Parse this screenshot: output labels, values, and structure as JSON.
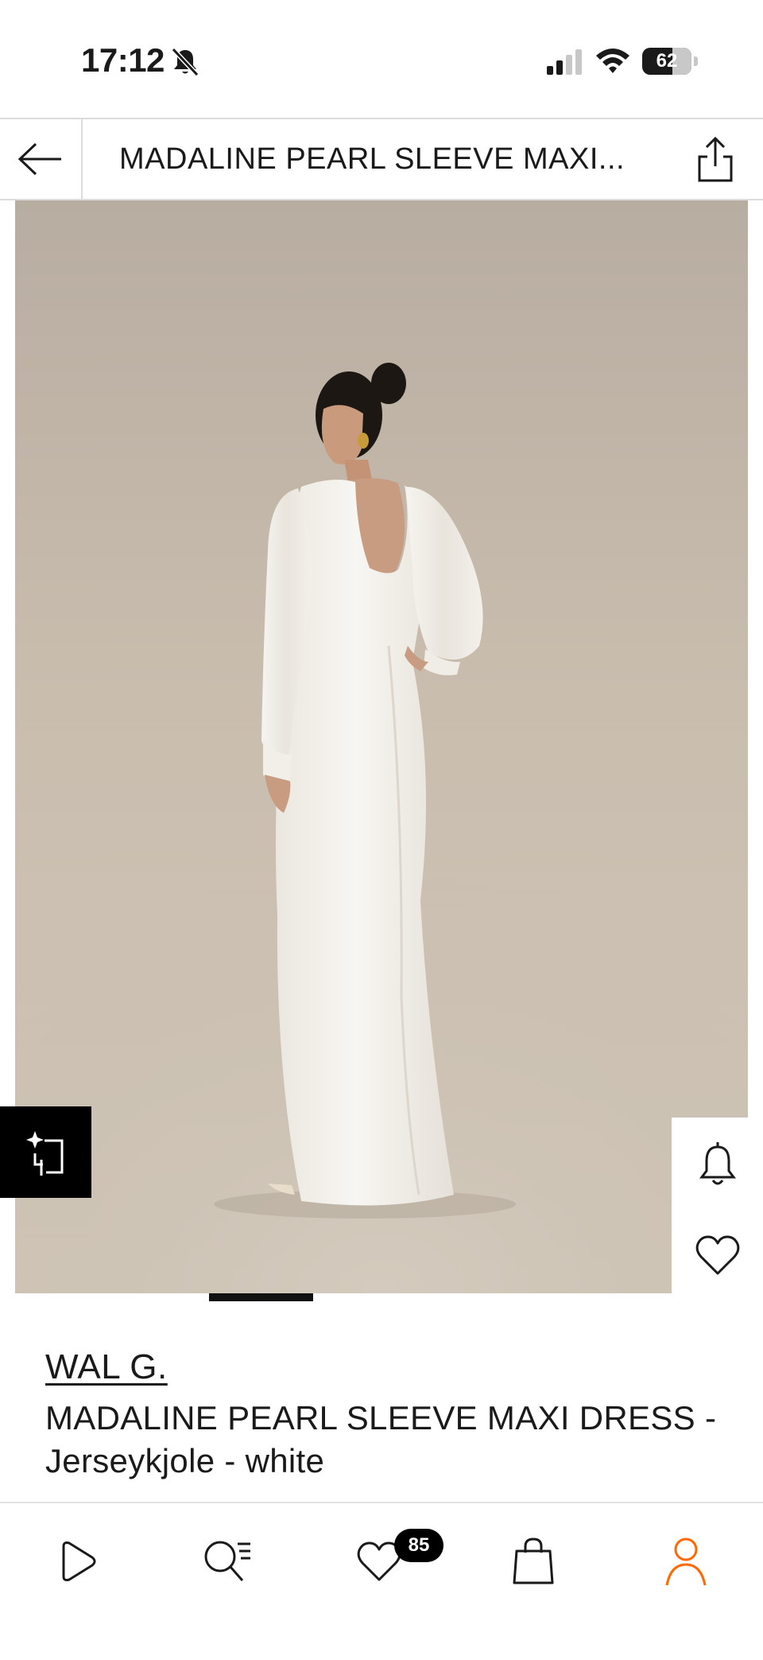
{
  "status_bar": {
    "time": "17:12",
    "battery": "62",
    "battery_level": 0.62,
    "icons": [
      "bell-slash-icon",
      "cellular-signal-icon",
      "wifi-icon",
      "battery-icon"
    ]
  },
  "header": {
    "title": "MADALINE PEARL SLEEVE MAXI...",
    "back_icon": "arrow-left-icon",
    "share_icon": "share-icon"
  },
  "gallery": {
    "image_description": "product photo",
    "similar_icon": "sparkle-crop-icon",
    "notify_icon": "bell-icon",
    "favorite_icon": "heart-icon",
    "colors": {
      "background": "#c6baab",
      "dress": "#f4f2ee"
    }
  },
  "product": {
    "brand": "WAL G.",
    "name": "MADALINE PEARL SLEEVE MAXI DRESS - Jerseykjole - white"
  },
  "bottom_nav": {
    "items": [
      {
        "icon": "play-icon"
      },
      {
        "icon": "search-list-icon"
      },
      {
        "icon": "heart-icon",
        "badge": "85"
      },
      {
        "icon": "shopping-bag-icon"
      },
      {
        "icon": "user-icon",
        "active": true
      }
    ],
    "accent_color": "#ff6900"
  }
}
